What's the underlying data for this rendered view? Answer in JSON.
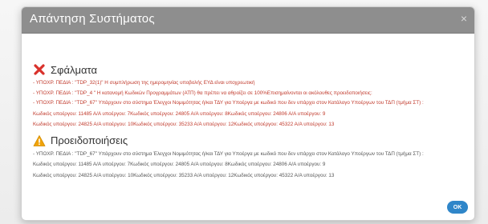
{
  "dialog": {
    "title": "Απάντηση Συστήματος",
    "close_label": "×",
    "ok_label": "OK"
  },
  "errors": {
    "icon": "error-x-icon",
    "color": "#d9312b",
    "title": "Σφάλματα",
    "messages": [
      "- ΥΠΟΧΡ. ΠΕΔΙΑ : \"TDP_32(1)\" Η συμπλήρωση της ημερομηνίας υποβολής ΕΥΔ είναι υποχρεωτική",
      "- ΥΠΟΧΡ. ΠΕΔΙΑ : \"TDP_4 \" Η κατανομή Κωδικών Προγραμμάτων (ΑΤΠ) θα πρέπει να αθροίζει σε 100%Επισημαίνονται οι ακόλουθες προειδοποιήσεις:",
      "- ΥΠΟΧΡ. ΠΕΔΙΑ : \"TDP_67\" Υπάρχουν στο σύστημα Έλεγχοι Νομιμότητας ή/και ΤΔΥ για Υποέργα με κωδικό που δεν υπάρχει στον Κατάλογο Υποέργων του ΤΔΠ (τμήμα ΣΤ) :"
    ],
    "counts": [
      "Κωδικός υποέργου: 11485 Α/Α υποέργου: 7Κωδικός υποέργου: 24805 Α/Α υποέργου: 8Κωδικός υποέργου: 24806 Α/Α υποέργου: 9",
      "Κωδικός υποέργου: 24825 Α/Α υποέργου: 10Κωδικός υποέργου: 35233 Α/Α υποέργου: 12Κωδικός υποέργου: 45322 Α/Α υποέργου: 13"
    ]
  },
  "warnings": {
    "icon": "warning-triangle-icon",
    "color": "#f0a30a",
    "title": "Προειδοποιήσεις",
    "messages": [
      "- ΥΠΟΧΡ. ΠΕΔΙΑ : \"TDP_67\" Υπάρχουν στο σύστημα Έλεγχοι Νομιμότητας ή/και ΤΔΥ για Υποέργα με κωδικό που δεν υπάρχει στον Κατάλογο Υποέργων του ΤΔΠ (τμήμα ΣΤ) :"
    ],
    "counts": [
      "Κωδικός υποέργου: 11485 Α/Α υποέργου: 7Κωδικός υποέργου: 24805 Α/Α υποέργου: 8Κωδικός υποέργου: 24806 Α/Α υποέργου: 9",
      "Κωδικός υποέργου: 24825 Α/Α υποέργου: 10Κωδικός υποέργου: 35233 Α/Α υποέργου: 12Κωδικός υποέργου: 45322 Α/Α υποέργου: 13"
    ]
  },
  "colors": {
    "header_bg": "#8e8e8e",
    "error_text": "#c0392b",
    "ok_button": "#2f86c9"
  }
}
